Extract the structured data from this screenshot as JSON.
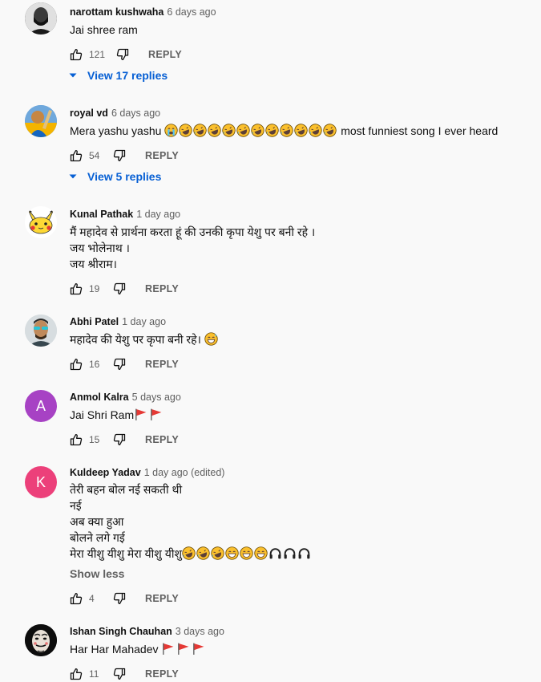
{
  "comments": [
    {
      "author": "narottam kushwaha",
      "time": "6 days ago",
      "lines": [
        "Jai shree ram"
      ],
      "likes": "121",
      "reply": "REPLY",
      "view_replies": "View 17 replies",
      "avatar": "dark-bearded-portrait"
    },
    {
      "author": "royal vd",
      "time": "6 days ago",
      "text_prefix": "Mera yashu yashu",
      "text_suffix": "most funniest song I ever heard",
      "likes": "54",
      "reply": "REPLY",
      "view_replies": "View 5 replies",
      "avatar": "cricket-photo"
    },
    {
      "author": "Kunal Pathak",
      "time": "1 day ago",
      "lines": [
        "मैं महादेव से प्रार्थना करता हूं की उनकी कृपा येशु पर बनी रहे ।",
        "जय भोलेनाथ ।",
        "जय श्रीराम।"
      ],
      "likes": "19",
      "reply": "REPLY",
      "avatar": "pikachu"
    },
    {
      "author": "Abhi Patel",
      "time": "1 day ago",
      "text_prefix": "महादेव की येशु पर कृपा बनी रहे।",
      "likes": "16",
      "reply": "REPLY",
      "avatar": "man-with-sunglasses"
    },
    {
      "author": "Anmol Kalra",
      "time": "5 days ago",
      "text_prefix": "Jai Shri Ram",
      "likes": "15",
      "reply": "REPLY",
      "avatar_letter": "A",
      "avatar_color": "#a742c4"
    },
    {
      "author": "Kuldeep Yadav",
      "time": "1 day ago (edited)",
      "lines": [
        "तेरी बहन बोल नई सकती थी",
        "नई",
        "अब क्या हुआ",
        "बोलने लगे गई"
      ],
      "last_line_prefix": "मेरा यीशु यीशु मेरा यीशु यीशु",
      "show_less": "Show less",
      "likes": "4",
      "reply": "REPLY",
      "avatar_letter": "K",
      "avatar_color": "#ec407a"
    },
    {
      "author": "Ishan Singh Chauhan",
      "time": "3 days ago",
      "text_prefix": "Har Har Mahadev",
      "likes": "11",
      "reply": "REPLY",
      "avatar": "money-heist-mask"
    }
  ],
  "colors": {
    "link": "#065fd4",
    "secondary": "#606060",
    "flag": "#e53935",
    "emoji": "#fbc02d"
  },
  "icons": [
    "thumb-up-icon",
    "thumb-down-icon",
    "expand-triangle-icon",
    "laughing-emoji-icon",
    "crying-emoji-icon",
    "grinning-emoji-icon",
    "headphones-icon",
    "red-flag-icon"
  ]
}
